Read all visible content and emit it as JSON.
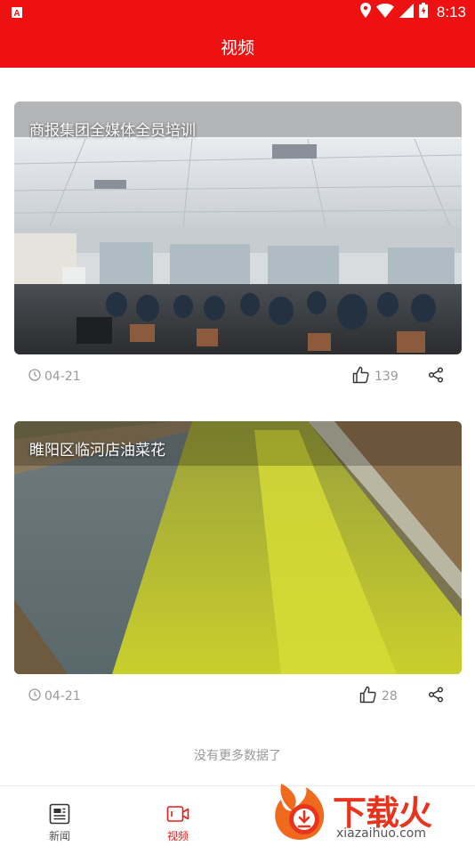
{
  "status_bar": {
    "time": "8:13"
  },
  "app_bar": {
    "title": "视频"
  },
  "videos": [
    {
      "title": "商报集团全媒体全员培训",
      "date": "04-21",
      "likes": "139",
      "banner_text": "商报集团全媒体全员培训"
    },
    {
      "title": "睢阳区临河店油菜花",
      "date": "04-21",
      "likes": "28"
    }
  ],
  "list_footer": "没有更多数据了",
  "bottom_nav": {
    "items": [
      {
        "label": "新闻",
        "icon": "newspaper-icon",
        "active": false
      },
      {
        "label": "视频",
        "icon": "video-camera-icon",
        "active": true
      }
    ]
  },
  "watermark": {
    "brand": "下载火",
    "url": "xiazaihuo.com"
  },
  "colors": {
    "primary": "#ee1111",
    "muted": "#999999",
    "active_nav": "#e51c1c"
  }
}
